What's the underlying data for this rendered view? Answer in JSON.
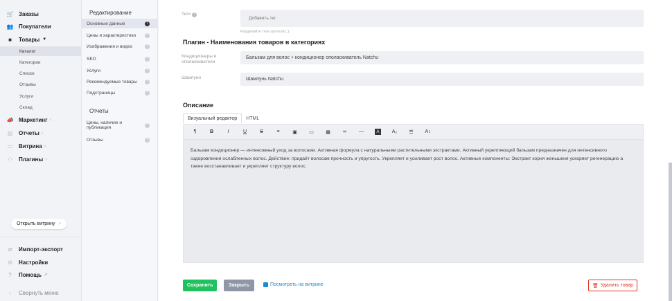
{
  "sidebar": {
    "orders": "Заказы",
    "customers": "Покупатели",
    "products": "Товары",
    "products_sub": [
      "Каталог",
      "Категории",
      "Списки",
      "Отзывы",
      "Услуги",
      "Склад"
    ],
    "marketing": "Маркетинг",
    "reports": "Отчеты",
    "storefront": "Витрина",
    "plugins": "Плагины",
    "open_storefront": "Открыть витрину",
    "import_export": "Импорт-экспорт",
    "settings": "Настройки",
    "help": "Помощь",
    "collapse": "Свернуть меню"
  },
  "submenu": {
    "editing_title": "Редактирование",
    "editing_items": [
      "Основные данные",
      "Цены и характеристики",
      "Изображения и видео",
      "SEO",
      "Услуги",
      "Рекомендуемые товары",
      "Подстраницы"
    ],
    "reports_title": "Отчеты",
    "reports_items": [
      "Цены, наличие и публикация",
      "Отзывы"
    ]
  },
  "main": {
    "tags_label": "Теги",
    "tags_placeholder": "Добавить тег",
    "tags_hint": "Разделяйте теги запятой (,).",
    "plugin_title": "Плагин - Наименования товаров в категориях",
    "cat1_label": "Кондиционеры и ополаскиватели",
    "cat1_value": "Бальзам для волос + кондиционер ополаскиватель Natchu",
    "cat2_label": "Шампуни",
    "cat2_value": "Шампунь Natchu",
    "description_title": "Описание",
    "tab_visual": "Визуальный редактор",
    "tab_html": "HTML",
    "description_text": "Бальзам кондиционер — интенсивный уход за волосами. Активная формула с натуральными растительными экстрактами. Активный укрепляющий бальзам предназначен для интенсивного оздоровления ослабленных волос. Действие: придаёт волосам прочность и упругость. Укрепляет и усиливает рост волос. Активные компоненты: Экстракт корня женьшеня ускоряет регенерацию а также восстанавливает и укрепляет структуру волос.",
    "toolbar": [
      "¶",
      "B",
      "I",
      "U",
      "S",
      "≡",
      "▣",
      "▭",
      "▦",
      "∞",
      "—",
      "A",
      "A₂",
      "☰",
      "A↕"
    ],
    "save": "Сохранить",
    "close": "Закрыть",
    "view_on_storefront": "Посмотреть на витрине",
    "delete_product": "Удалить товар"
  },
  "colors": {
    "accent_green": "#21c15f",
    "danger_red": "#e0301e",
    "link_blue": "#1e8ad6"
  }
}
